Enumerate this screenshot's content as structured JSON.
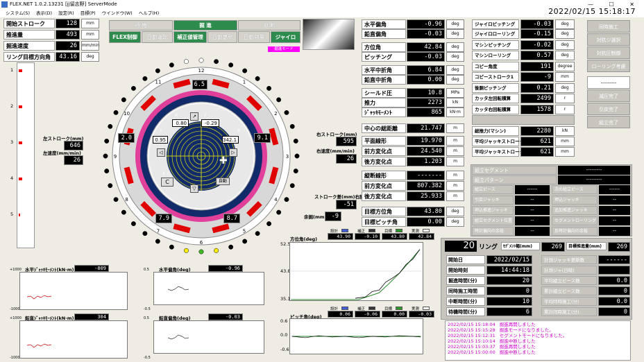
{
  "window": {
    "title": "FLEX.NET 1.0.2.13231 [jj留志野] ServerMode"
  },
  "menu": [
    "システム(S)",
    "表示(D)",
    "設定(R)",
    "目標(P)",
    "ウインドウ(W)",
    "ヘルプ(H)"
  ],
  "datetime": "2022/02/15 15:18:17",
  "left_params": [
    {
      "label": "開始ストローク",
      "value": "128",
      "unit": "mm"
    },
    {
      "label": "推進量",
      "value": "493",
      "unit": "mm"
    },
    {
      "label": "掘進速度",
      "value": "26",
      "unit": "mm/min"
    },
    {
      "label": "リング目標方向角",
      "value": "43.16",
      "unit": "deg"
    }
  ],
  "mode_tabs": [
    {
      "label": "待 機",
      "buttons": [
        "FLEX制御",
        "自動運転"
      ]
    },
    {
      "label": "掘 進",
      "buttons": [
        "補正値管理",
        "自動更新"
      ]
    },
    {
      "label": "中 断",
      "buttons": [
        "自動測量",
        "ジャイロ"
      ]
    }
  ],
  "status_tag": "掘進モード",
  "stroke_scale": [
    "1",
    "2",
    "3",
    "4",
    "5"
  ],
  "left_stroke": {
    "label": "左ストローク(mm)",
    "value": "646",
    "speed_label": "左速度(mm/min)",
    "speed": "26"
  },
  "right_stroke": {
    "label": "右ストローク(mm)",
    "value": "595",
    "speed_label": "右速度(mm/min)",
    "speed": "26"
  },
  "stroke_diff": {
    "label": "ストローク差(mm)右勝",
    "value": "-51"
  },
  "clearance": {
    "label": "余掘(mm)",
    "value": "-9"
  },
  "ring": {
    "top_val": "6.5",
    "left_val": "2.0",
    "right_val": "9.1",
    "bl_val": "7.9",
    "br_val": "8.7",
    "x_val": "0.80",
    "y_val": "-0.29",
    "left_small": "0.95",
    "theta_val": "342.1",
    "x_label": "X",
    "y_label": "Y",
    "theta_label": "θ",
    "x1": "X 1",
    "c_btn": "C",
    "auto_btn": "自動",
    "numbers": [
      "12",
      "1",
      "2",
      "3",
      "4",
      "5",
      "6",
      "7",
      "8",
      "9",
      "10",
      "11"
    ]
  },
  "mid_params": [
    {
      "label": "水平偏角",
      "value": "-0.96",
      "unit": "deg"
    },
    {
      "label": "鉛直偏角",
      "value": "-0.03",
      "unit": "deg"
    },
    {
      "label": "方位角",
      "value": "42.84",
      "unit": "deg"
    },
    {
      "label": "ピッチング",
      "value": "-0.03",
      "unit": "deg"
    },
    {
      "label": "水平中折角",
      "value": "6.84",
      "unit": "deg"
    },
    {
      "label": "鉛直中折角",
      "value": "0.00",
      "unit": "deg"
    },
    {
      "label": "シールド圧",
      "value": "10.8",
      "unit": "MPa"
    },
    {
      "label": "推力",
      "value": "2273",
      "unit": "kN"
    },
    {
      "label": "ｼﾞｬｯｷﾓｰﾒﾝﾄ",
      "value": "865",
      "unit": "kN·m"
    },
    {
      "label": "中心の総距離",
      "value": "21.747",
      "unit": "m"
    },
    {
      "label": "平面線形",
      "value": "19.970",
      "unit": "m"
    },
    {
      "label": "前方変化点",
      "value": "24.540",
      "unit": "m"
    },
    {
      "label": "後方変化点",
      "value": "1.203",
      "unit": "m"
    },
    {
      "label": "縦断線形",
      "value": "-------",
      "unit": "m"
    },
    {
      "label": "前方変化点",
      "value": "807.382",
      "unit": "m"
    },
    {
      "label": "後方変化点",
      "value": "25.933",
      "unit": "m"
    },
    {
      "label": "目標方位角",
      "value": "43.80",
      "unit": "deg"
    },
    {
      "label": "目標ピッチ角",
      "value": "0.00",
      "unit": "deg"
    }
  ],
  "right_params": [
    {
      "label": "ジャイロピッチング",
      "value": "-0.03",
      "unit": "deg"
    },
    {
      "label": "ジャイロローリング",
      "value": "-0.15",
      "unit": "deg"
    },
    {
      "label": "マシンピッチング",
      "value": "-0.02",
      "unit": "deg"
    },
    {
      "label": "マシンローリング",
      "value": "0.57",
      "unit": "deg"
    },
    {
      "label": "コピー角度",
      "value": "191",
      "unit": "degree"
    },
    {
      "label": "コピーストローク1",
      "value": "-9",
      "unit": "mm"
    },
    {
      "label": "後胴ピッチング",
      "value": "0.21",
      "unit": "deg"
    },
    {
      "label": "カッタ左回転積算",
      "value": "2499",
      "unit": "r"
    },
    {
      "label": "カッタ右回転積算",
      "value": "1578",
      "unit": "r"
    },
    {
      "label": "",
      "value": "",
      "unit": ""
    },
    {
      "label": "総推力(マシン)",
      "value": "2280",
      "unit": "kN"
    },
    {
      "label": "平均ジャッキストローク",
      "value": "621",
      "unit": "mm"
    },
    {
      "label": "平均ジャッキストローク",
      "value": "621",
      "unit": "mm"
    }
  ],
  "side_buttons": [
    "同時施工",
    "対抗ジ選択",
    "対抗圧制御",
    "ローリング考慮",
    "---------",
    "減圧完了",
    "引戻完了",
    "組立完了"
  ],
  "assembly": {
    "rows": [
      {
        "label": "組立セグメント",
        "value": "---------"
      },
      {
        "label": "組立パターン",
        "value": "---------"
      }
    ],
    "pieces": [
      {
        "l1": "組立ピース",
        "v1": "------",
        "l2": "次の組立ピース",
        "v2": "------"
      },
      {
        "l1": "引戻ジャッキ",
        "v1": "--",
        "l2": "押込ジャッキ",
        "v2": "--"
      },
      {
        "l1": "押込推進ジャッキ",
        "v1": "--",
        "l2": "追加推進ジャッキ",
        "v2": "--"
      },
      {
        "l1": "組立セグメント位置",
        "v1": "--",
        "l2": "セグメントローリング(deg)",
        "v2": "--"
      },
      {
        "l1": "時計偏向の余裕(deg)",
        "v1": "--",
        "l2": "反時計偏向の余裕(deg)",
        "v2": "--"
      }
    ]
  },
  "ring_info": {
    "ring_no": "20",
    "ring_label": "リング",
    "seg_width_label": "ｾｸﾞﾒﾝﾄ幅(mm)",
    "seg_width": "269",
    "target_len_label": "目標推進量(mm)",
    "target_len": "269",
    "rows": [
      {
        "label": "開始日",
        "value": "2022/02/15",
        "r_label": "計測ジャッキ更新数",
        "r_value": "------"
      },
      {
        "label": "開始時刻",
        "value": "14:44:18",
        "r_label": "計測ジャ(日時)",
        "r_value": ""
      },
      {
        "label": "掘進時間(分)",
        "value": "20",
        "r_label": "平均組立ピース数",
        "r_value": "0.0"
      },
      {
        "label": "同時施工時間(分)",
        "value": "0",
        "r_label": "累計組立ピース数",
        "r_value": "0"
      },
      {
        "label": "中断時間(分)",
        "value": "10",
        "r_label": "平均同時施工(分)",
        "r_value": "0.0"
      },
      {
        "label": "待機時間(分)",
        "value": "6",
        "r_label": "累計同時施工(分)",
        "r_value": "0"
      }
    ]
  },
  "log": [
    {
      "time": "2022/02/15 15:18:04",
      "msg": "掘進再開しました"
    },
    {
      "time": "2022/02/15 15:15:28",
      "msg": "掘進モードになりました。"
    },
    {
      "time": "2022/02/15 15:12:31",
      "msg": "セグメントモードになりました。"
    },
    {
      "time": "2022/02/15 15:10:14",
      "msg": "掘進中断しました"
    },
    {
      "time": "2022/02/15 15:03:37",
      "msg": "掘進再開しました"
    },
    {
      "time": "2022/02/15 15:00:00",
      "msg": "掘進中断しました"
    }
  ],
  "mini_charts": [
    {
      "title": "水平ｼﾞｬｯｷﾓｰﾒﾝﾄ(kN·m)",
      "value": "-809",
      "ymax": "+1000",
      "ymin": "-1000"
    },
    {
      "title": "鉛直ｼﾞｬｯｷﾓｰﾒﾝﾄ(kN·m)",
      "value": "304",
      "ymax": "+1000",
      "ymin": "-1000"
    },
    {
      "title": "水平偏角(deg)",
      "value": "-0.96",
      "ymax": "0.5",
      "ymin": "-0.5"
    },
    {
      "title": "鉛直偏角(deg)",
      "value": "-0.03",
      "ymax": "0.5",
      "ymin": "-0.5"
    }
  ],
  "azimuth_chart": {
    "title": "方位角(deg)",
    "legend": [
      "設計",
      "補正",
      "目標",
      "実測"
    ],
    "values": [
      "43.90",
      "-0.10",
      "43.80",
      "42.84"
    ],
    "yticks": [
      "52.5",
      "43.8",
      "35.1"
    ]
  },
  "pitch_chart": {
    "title": "ピッチ角(deg)",
    "legend": [
      "設計",
      "補正",
      "目標",
      "実測"
    ],
    "values": [
      "0.06",
      "-0.06",
      "0.00",
      "-0.03"
    ],
    "yticks": [
      "0.6",
      "0.0",
      "-0.6"
    ]
  },
  "colors": {
    "accent_green": "#2e8b4e",
    "segment_red": "#e00000",
    "ring_pink": "#e0409a",
    "ring_blue": "#102a6a"
  }
}
